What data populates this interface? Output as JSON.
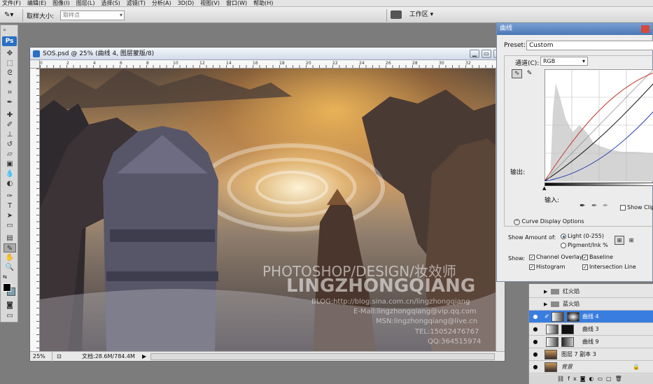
{
  "menu": [
    "文件(F)",
    "编辑(E)",
    "图像(I)",
    "图层(L)",
    "选择(S)",
    "滤镜(T)",
    "分析(A)",
    "3D(D)",
    "视图(V)",
    "窗口(W)",
    "帮助(H)"
  ],
  "options_bar": {
    "sample_size_label": "取样大小:",
    "sample_size_value": "取样点",
    "workspace_label": "工作区"
  },
  "document": {
    "title": "SOS.psd @ 25% (曲线 4, 图层蒙版/8)",
    "zoom": "25%",
    "doc_size": "文档:28.6M/784.4M",
    "ruler_ticks": [
      "0",
      "2",
      "4",
      "6",
      "8",
      "10",
      "12",
      "14",
      "16",
      "18",
      "20",
      "22",
      "24",
      "26",
      "28",
      "30",
      "32"
    ]
  },
  "watermark": {
    "line1": "PHOTOSHOP/DESIGN/妆效师",
    "line2": "LINGZHONGQIANG",
    "blog": "BLOG:http://blog.sina.com.cn/lingzhongqiang",
    "email": "E-Mail:lingzhongqiang@vip.qq.com",
    "msn": "MSN:lingzhongqiang@live.cn",
    "tel": "TEL:15052476767",
    "qq": "QQ:364515974"
  },
  "curves_dialog": {
    "title": "曲线",
    "preset_label": "Preset:",
    "preset_value": "Custom",
    "channel_label": "通道(C):",
    "channel_value": "RGB",
    "output_label": "输出:",
    "input_label": "输入:",
    "show_clipping": "Show Clipp",
    "curve_display_options": "Curve Display Options",
    "show_amount_label": "Show Amount of:",
    "light_option": "Light  (0-255)",
    "pigment_option": "Pigment/Ink %",
    "show_label": "Show:",
    "channel_overlays": "Channel Overlays",
    "baseline": "Baseline",
    "histogram": "Histogram",
    "intersection_line": "Intersection Line"
  },
  "layers": [
    {
      "name": "红火焰",
      "type": "group"
    },
    {
      "name": "蓝火焰",
      "type": "group"
    },
    {
      "name": "曲线 4",
      "type": "adjustment",
      "selected": true
    },
    {
      "name": "曲线 3",
      "type": "adjustment"
    },
    {
      "name": "曲线 9",
      "type": "adjustment"
    },
    {
      "name": "图层 7 副本 3",
      "type": "pixel"
    },
    {
      "name": "背景",
      "type": "background"
    }
  ],
  "colors": {
    "accent": "#3a7de0",
    "dialog_title": "#4b77b6",
    "curve_red": "#c0392b",
    "curve_blue": "#2c3fb0",
    "curve_black": "#111111"
  }
}
